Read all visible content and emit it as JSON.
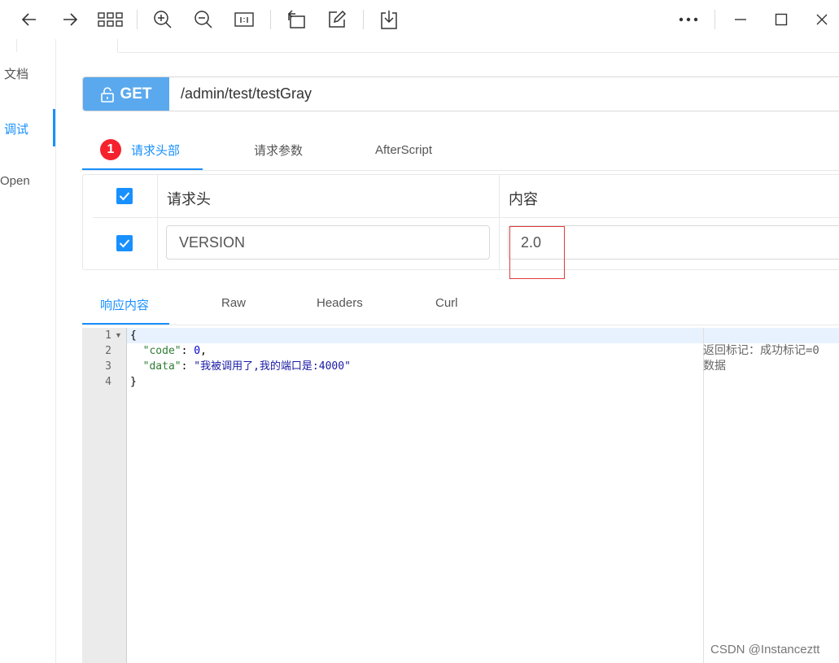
{
  "toolbar": {
    "icons": [
      "back-icon",
      "forward-icon",
      "grid-icon",
      "zoom-in-icon",
      "zoom-out-icon",
      "actual-size-icon",
      "rotate-icon",
      "edit-icon",
      "download-icon",
      "more-icon",
      "minimize-icon",
      "maximize-icon",
      "close-icon"
    ]
  },
  "sidebar": {
    "items": [
      {
        "label": "文档"
      },
      {
        "label": "调试",
        "active": true
      },
      {
        "label": "Open"
      }
    ]
  },
  "request": {
    "method": "GET",
    "url": "/admin/test/testGray",
    "tabs": [
      {
        "label": "请求头部",
        "badge": "1",
        "active": true
      },
      {
        "label": "请求参数"
      },
      {
        "label": "AfterScript"
      }
    ],
    "headers_table": {
      "columns": [
        "请求头",
        "内容"
      ],
      "rows": [
        {
          "checked": true,
          "name": "VERSION",
          "value": "2.0"
        }
      ]
    }
  },
  "response": {
    "tabs": [
      {
        "label": "响应内容",
        "active": true
      },
      {
        "label": "Raw"
      },
      {
        "label": "Headers"
      },
      {
        "label": "Curl"
      }
    ],
    "line_numbers": [
      "1",
      "2",
      "3",
      "4"
    ],
    "code": {
      "open": "{",
      "line2_key": "\"code\"",
      "line2_value": "0",
      "line3_key": "\"data\"",
      "line3_value": "\"我被调用了,我的端口是:4000\"",
      "close": "}"
    },
    "descriptions": [
      "返回标记：成功标记=0",
      "数据"
    ]
  },
  "watermark": "CSDN @Instanceztt",
  "colors": {
    "accent": "#1890ff",
    "method_bg": "#5aa9ee",
    "badge": "#f5222d",
    "highlight_box": "#e03c3c"
  }
}
